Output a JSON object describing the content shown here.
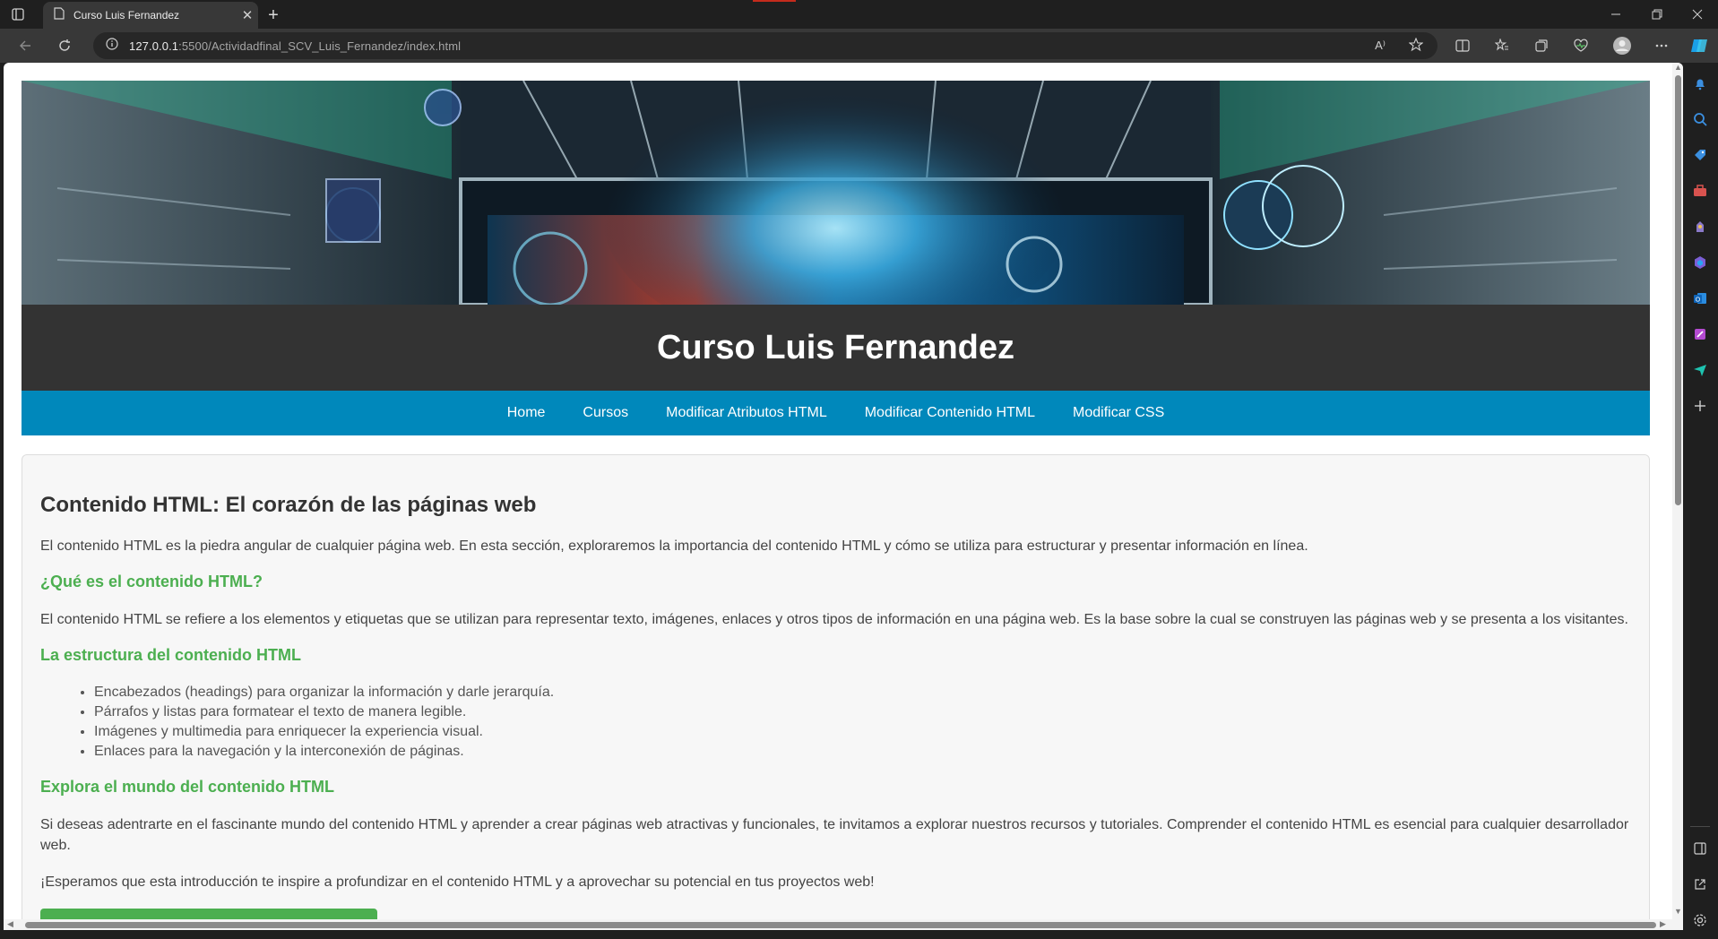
{
  "browser": {
    "tab_title": "Curso Luis Fernandez",
    "url_host": "127.0.0.1",
    "url_rest": ":5500/Actividadfinal_SCV_Luis_Fernandez/index.html",
    "read_aloud_label": "A⁾"
  },
  "site": {
    "title": "Curso Luis Fernandez",
    "nav": [
      "Home",
      "Cursos",
      "Modificar Atributos HTML",
      "Modificar Contenido HTML",
      "Modificar CSS"
    ]
  },
  "content": {
    "heading": "Contenido HTML: El corazón de las páginas web",
    "intro": "El contenido HTML es la piedra angular de cualquier página web. En esta sección, exploraremos la importancia del contenido HTML y cómo se utiliza para estructurar y presentar información en línea.",
    "section1_title": "¿Qué es el contenido HTML?",
    "section1_text": "El contenido HTML se refiere a los elementos y etiquetas que se utilizan para representar texto, imágenes, enlaces y otros tipos de información en una página web. Es la base sobre la cual se construyen las páginas web y se presenta a los visitantes.",
    "section2_title": "La estructura del contenido HTML",
    "section2_items": [
      "Encabezados (headings) para organizar la información y darle jerarquía.",
      "Párrafos y listas para formatear el texto de manera legible.",
      "Imágenes y multimedia para enriquecer la experiencia visual.",
      "Enlaces para la navegación y la interconexión de páginas."
    ],
    "section3_title": "Explora el mundo del contenido HTML",
    "section3_text": "Si deseas adentrarte en el fascinante mundo del contenido HTML y aprender a crear páginas web atractivas y funcionales, te invitamos a explorar nuestros recursos y tutoriales. Comprender el contenido HTML es esencial para cualquier desarrollador web.",
    "closing": "¡Esperamos que esta introducción te inspire a profundizar en el contenido HTML y a aprovechar su potencial en tus proyectos web!"
  },
  "colors": {
    "header_bg": "#333333",
    "nav_bg": "#0088bb",
    "section_title": "#4caf50"
  }
}
